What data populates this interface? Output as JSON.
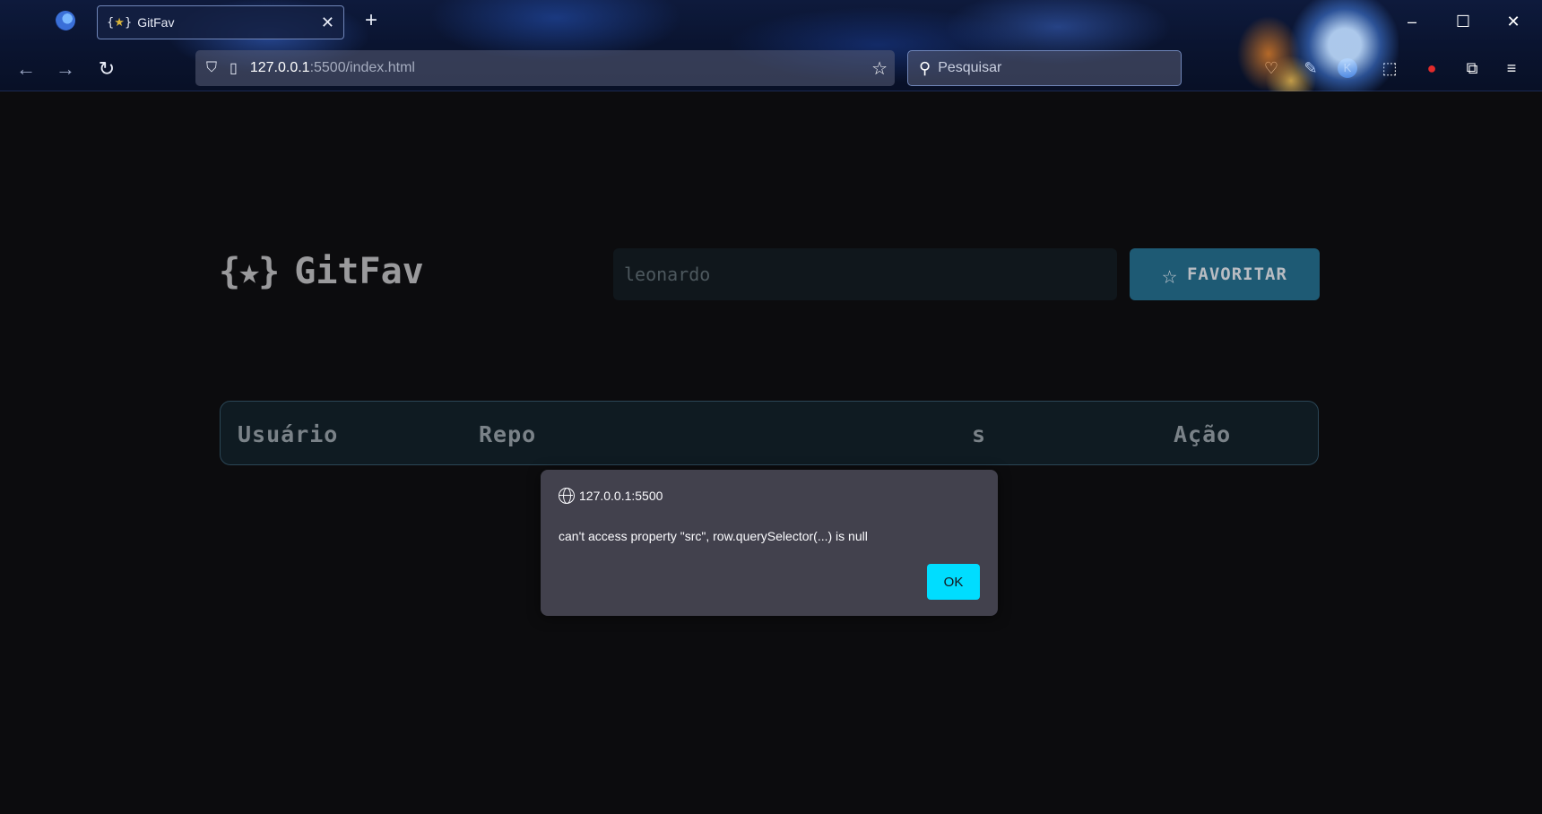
{
  "browser": {
    "tab_title": "GitFav",
    "tab_favicon": "{★}",
    "new_tab_label": "+",
    "url_host": "127.0.0.1",
    "url_path": ":5500/index.html",
    "search_placeholder": "Pesquisar",
    "minimize": "–",
    "maximize": "☐",
    "close": "✕",
    "colors": {
      "accent": "#00ddff",
      "chrome": "#0a1430"
    }
  },
  "app": {
    "logo_mark": "{★}",
    "logo_text": "GitFav",
    "search_value": "leonardo",
    "favorite_label": "FAVORITAR",
    "columns": [
      "Usuário",
      "Repo",
      "s",
      "Ação"
    ],
    "colors": {
      "button": "#1e5a74",
      "header_border": "#2b4656",
      "text": "#9a9a9c"
    }
  },
  "dialog": {
    "origin": "127.0.0.1:5500",
    "message": "can't access property \"src\", row.querySelector(...) is null",
    "ok_label": "OK"
  }
}
